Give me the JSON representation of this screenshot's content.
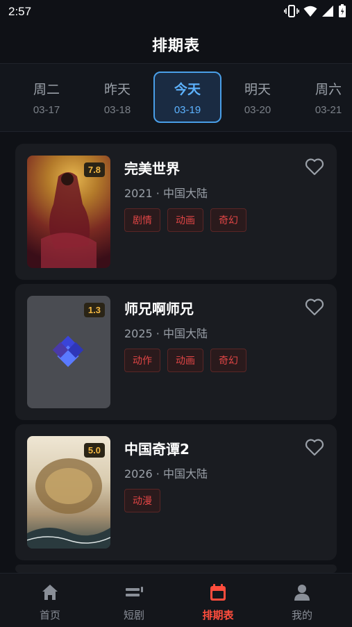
{
  "status": {
    "time": "2:57"
  },
  "header": {
    "title": "排期表"
  },
  "dates": [
    {
      "day": "周二",
      "date": "03-17"
    },
    {
      "day": "昨天",
      "date": "03-18"
    },
    {
      "day": "今天",
      "date": "03-19"
    },
    {
      "day": "明天",
      "date": "03-20"
    },
    {
      "day": "周六",
      "date": "03-21"
    }
  ],
  "cards": [
    {
      "title": "完美世界",
      "meta": "2021 · 中国大陆",
      "rating": "7.8",
      "tags": [
        "剧情",
        "动画",
        "奇幻"
      ]
    },
    {
      "title": "师兄啊师兄",
      "meta": "2025 · 中国大陆",
      "rating": "1.3",
      "tags": [
        "动作",
        "动画",
        "奇幻"
      ]
    },
    {
      "title": "中国奇谭2",
      "meta": "2026 · 中国大陆",
      "rating": "5.0",
      "tags": [
        "动漫"
      ]
    }
  ],
  "tabs": [
    {
      "label": "首页",
      "icon": "home-icon"
    },
    {
      "label": "短剧",
      "icon": "short-drama-icon"
    },
    {
      "label": "排期表",
      "icon": "calendar-icon"
    },
    {
      "label": "我的",
      "icon": "user-icon"
    }
  ],
  "colors": {
    "accent_blue": "#4a9fe8",
    "accent_red": "#ff4d3d",
    "rating_gold": "#f5b942"
  }
}
